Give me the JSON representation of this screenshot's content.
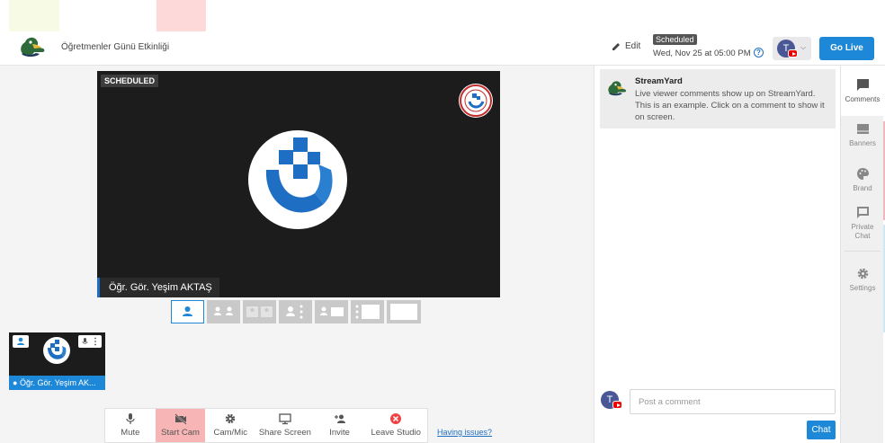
{
  "header": {
    "title": "Öğretmenler Günü Etkinliği",
    "edit_label": "Edit",
    "scheduled_badge": "Scheduled",
    "scheduled_date": "Wed, Nov 25 at 05:00 PM",
    "help_glyph": "?",
    "account_initial": "T",
    "go_live_label": "Go Live"
  },
  "stage": {
    "badge": "SCHEDULED",
    "name": "Öğr. Gör. Yeşim AKTAŞ"
  },
  "layouts": [
    "solo",
    "split",
    "split-small",
    "group",
    "pip",
    "sidebar",
    "fullscreen"
  ],
  "participant": {
    "name": "Öğr. Gör. Yeşim AK..."
  },
  "controls": [
    {
      "label": "Mute",
      "icon": "mic-icon"
    },
    {
      "label": "Start Cam",
      "icon": "camera-off-icon"
    },
    {
      "label": "Cam/Mic",
      "icon": "gear-icon"
    },
    {
      "label": "Share Screen",
      "icon": "monitor-icon"
    },
    {
      "label": "Invite",
      "icon": "add-person-icon"
    },
    {
      "label": "Leave Studio",
      "icon": "close-circle-icon"
    }
  ],
  "having_issues": "Having issues?",
  "comments": {
    "items": [
      {
        "author": "StreamYard",
        "text": "Live viewer comments show up on StreamYard. This is an example. Click on a comment to show it on screen."
      }
    ],
    "input_placeholder": "Post a comment",
    "chat_label": "Chat",
    "user_initial": "T"
  },
  "rail": [
    {
      "label": "Comments",
      "icon": "comment-icon"
    },
    {
      "label": "Banners",
      "icon": "banner-icon"
    },
    {
      "label": "Brand",
      "icon": "palette-icon"
    },
    {
      "label": "Private Chat",
      "icon": "chat-icon"
    },
    {
      "label": "Settings",
      "icon": "gear-icon"
    }
  ],
  "colors": {
    "accent": "#1e88d8",
    "stage_bg": "#1c1c1c",
    "hot_control": "#f7b5b5",
    "brand_blue": "#1e6fc4"
  }
}
